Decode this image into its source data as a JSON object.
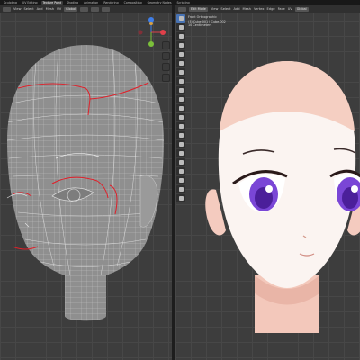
{
  "workspace_tabs": [
    "Sculpting",
    "UV Editing",
    "Texture Paint",
    "Shading",
    "Animation",
    "Rendering",
    "Compositing",
    "Geometry Nodes",
    "Scripting"
  ],
  "active_workspace": "Texture Paint",
  "left_viewport": {
    "header": {
      "menus": [
        "View",
        "Select",
        "Add",
        "Mesh",
        "UV"
      ],
      "orientation": "Global"
    }
  },
  "right_viewport": {
    "header": {
      "mode": "Edit Mode",
      "menus": [
        "View",
        "Select",
        "Add",
        "Mesh",
        "Vertex",
        "Edge",
        "Face",
        "UV"
      ],
      "orientation": "Global"
    },
    "overlay_info": {
      "line1": "Front Orthographic",
      "line2": "(3) Cube.001 | Cube.002",
      "line3": "10 Centimeters"
    }
  },
  "colors": {
    "wire": "#d0d0d0",
    "seam": "#e0202a",
    "skin_light": "#fbf4f1",
    "skin_shadow": "#f5cfc2",
    "iris": "#7a46d6",
    "gizmo_x": "#e0404a",
    "gizmo_y": "#7bc03a",
    "gizmo_z": "#3f7ee8"
  }
}
